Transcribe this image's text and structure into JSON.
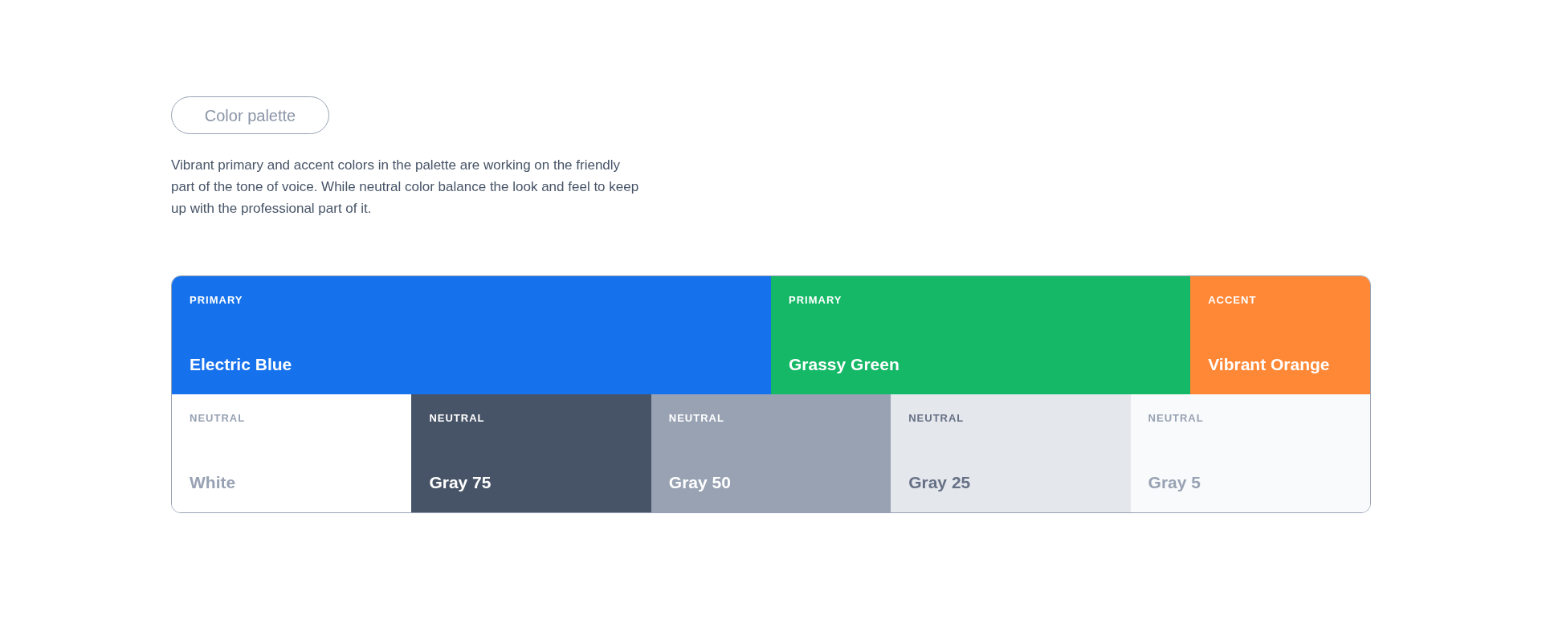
{
  "badge": "Color palette",
  "description": "Vibrant primary and accent colors in the palette are working on the friendly part of the tone of voice. While neutral color balance the look and feel to keep up with the professional part of it.",
  "rows": [
    {
      "swatches": [
        {
          "category": "PRIMARY",
          "name": "Electric Blue",
          "color": "#1672ec",
          "kind": "light"
        },
        {
          "category": "PRIMARY",
          "name": "Grassy Green",
          "color": "#14b866",
          "kind": "light"
        },
        {
          "category": "ACCENT",
          "name": "Vibrant Orange",
          "color": "#ff8837",
          "kind": "light"
        }
      ]
    },
    {
      "swatches": [
        {
          "category": "NEUTRAL",
          "name": "White",
          "color": "#ffffff",
          "kind": "muted"
        },
        {
          "category": "NEUTRAL",
          "name": "Gray 75",
          "color": "#475467",
          "kind": "light"
        },
        {
          "category": "NEUTRAL",
          "name": "Gray 50",
          "color": "#98a2b3",
          "kind": "light"
        },
        {
          "category": "NEUTRAL",
          "name": "Gray 25",
          "color": "#e4e7ec",
          "kind": "pale"
        },
        {
          "category": "NEUTRAL",
          "name": "Gray 5",
          "color": "#f9fafb",
          "kind": "muted"
        }
      ]
    }
  ]
}
